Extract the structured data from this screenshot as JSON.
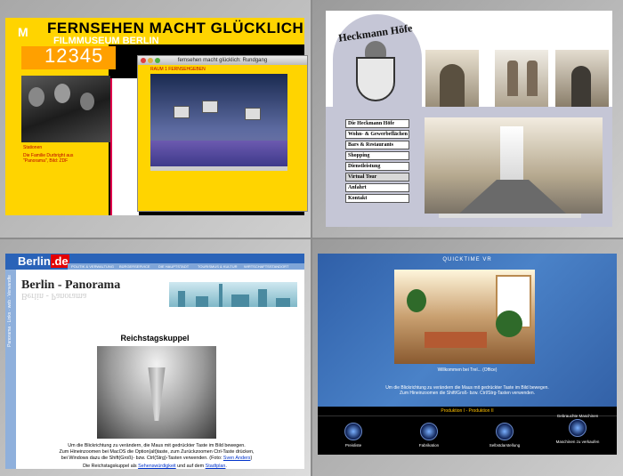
{
  "panels": {
    "filmmuseum": {
      "headline": "FERNSEHEN MACHT GLÜCKLICH",
      "subtitle": "FILMMUSEUM BERLIN",
      "logo_letter": "M",
      "numbers": "12345",
      "popup_title": "fernsehen macht glücklich: Rundgang",
      "popup_heading": "RAUM 1 FERNSEHGEBEN",
      "caption_top": "Stationen",
      "caption": "Die Familie Durbright aus \"Panorama\", Bild: ZDF"
    },
    "heckmann": {
      "crest_name": "Heckmann Höfe",
      "menu": [
        "Die Heckmann Höfe",
        "Wohn- & Gewerbeflächen",
        "Bars & Restaurants",
        "Shopping",
        "Dienstleistung",
        "Virtual Tour",
        "Anfahrt",
        "Kontakt"
      ],
      "selected": "Virtual Tour"
    },
    "berlin": {
      "brand_main": "Berlin",
      "brand_tld": ".de",
      "nav": [
        "POLITIK & VERWALTUNG",
        "BÜRGERSERVICE",
        "DIE HAUPTSTADT",
        "TOURISMUS & KULTUR",
        "WIRTSCHAFTSSTANDORT"
      ],
      "vertical_nav": "Panorama · Links · web · Verwandte",
      "page_title": "Berlin - Panorama",
      "section_title": "Reichstagskuppel",
      "para_line1": "Um die Blickrichtung zu verändern, die Maus mit gedrückter Taste im Bild bewegen.",
      "para_line2": "Zum Hineinzoomen bei MacOS die Option(alt)taste, zum Zurückzoomen Ctrl-Taste drücken,",
      "para_line3": "bei Windows dazu die Shift(Groß)- bzw. Ctrl(Strg)-Tasten verwenden. (Foto: ",
      "para_credit": "Sven Anders",
      "para_end": ")",
      "foot_pre": "Die Reichstagskuppel als ",
      "foot_link1": "Sehenswürdigkeit",
      "foot_mid": " und auf dem ",
      "foot_link2": "Stadtplan",
      "foot_end": "."
    },
    "quicktime": {
      "header": "QUICKTIME VR",
      "welcome": "Willkommen bei Trel... (Office)",
      "instr1": "Um die Blickrichtung zu verändern die Maus mit gedrückter Taste im Bild bewegen.",
      "instr2": "Zum Hineinzoomen die Shift/Groß- bzw. Ctrl/Strg-Tasten verwenden.",
      "production": "Produktion I - Produktion II",
      "buttons": [
        {
          "top": "",
          "label": "Preisliste"
        },
        {
          "top": "",
          "label": "Fabrikation"
        },
        {
          "top": "",
          "label": "Selbstdarstellung"
        },
        {
          "top": "Gebrauchte Maschinen",
          "label": "Maschinen zu verkaufen"
        }
      ]
    }
  }
}
